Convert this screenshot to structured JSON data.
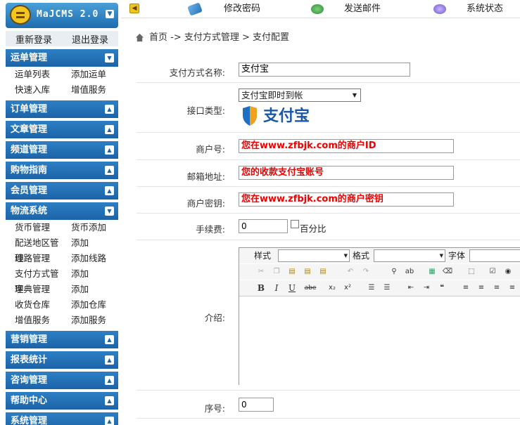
{
  "logo": {
    "text": "MaJCMS 2.0"
  },
  "auth": {
    "relogin": "重新登录",
    "logout": "退出登录"
  },
  "topnav": {
    "change_password": "修改密码",
    "send_mail": "发送邮件",
    "system_status": "系统状态"
  },
  "sidebar": {
    "sections": [
      {
        "title": "运单管理",
        "expanded": true,
        "items": [
          [
            "运单列表",
            "添加运单"
          ],
          [
            "快速入库",
            "增值服务"
          ]
        ]
      },
      {
        "title": "订单管理",
        "expanded": false
      },
      {
        "title": "文章管理",
        "expanded": false
      },
      {
        "title": "频道管理",
        "expanded": false
      },
      {
        "title": "购物指南",
        "expanded": false
      },
      {
        "title": "会员管理",
        "expanded": false
      },
      {
        "title": "物流系统",
        "expanded": true,
        "items": [
          [
            "货币管理",
            "货币添加"
          ],
          [
            "配送地区管理",
            "添加"
          ],
          [
            "线路管理",
            "添加线路"
          ],
          [
            "支付方式管理",
            "添加"
          ],
          [
            "字典管理",
            "添加"
          ],
          [
            "收货仓库",
            "添加仓库"
          ],
          [
            "增值服务",
            "添加服务"
          ]
        ]
      },
      {
        "title": "营销管理",
        "expanded": false
      },
      {
        "title": "报表统计",
        "expanded": false
      },
      {
        "title": "咨询管理",
        "expanded": false
      },
      {
        "title": "帮助中心",
        "expanded": false
      },
      {
        "title": "系统管理",
        "expanded": false
      }
    ]
  },
  "breadcrumb": "首页 -> 支付方式管理 > 支付配置",
  "form": {
    "name_label": "支付方式名称:",
    "name_value": "支付宝",
    "interface_label": "接口类型:",
    "interface_value": "支付宝即时到帐",
    "alipay_logo_text": "支付宝",
    "merchant_label": "商户号:",
    "merchant_value": "您在www.zfbjk.com的商户ID",
    "email_label": "邮箱地址:",
    "email_value": "您的收款支付宝账号",
    "key_label": "商户密钥:",
    "key_value": "您在www.zfbjk.com的商户密钥",
    "fee_label": "手续费:",
    "fee_value": "0",
    "percent_label": "百分比",
    "intro_label": "介绍:",
    "order_label": "序号:",
    "order_value": "0"
  },
  "editor": {
    "style_label": "样式",
    "format_label": "格式",
    "font_label": "字体"
  },
  "colors": {
    "sidebar_header": "#1c63a8",
    "alert_red": "#ee0000",
    "login_bar": "#e9eef3"
  }
}
